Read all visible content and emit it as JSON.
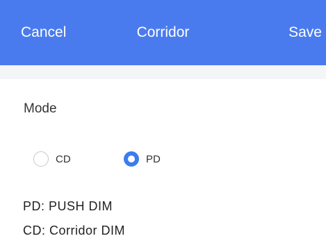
{
  "navbar": {
    "cancel_label": "Cancel",
    "title": "Corridor",
    "save_label": "Save",
    "background_color": "#4a7bee"
  },
  "mode": {
    "label": "Mode",
    "options": [
      {
        "label": "CD",
        "selected": false
      },
      {
        "label": "PD",
        "selected": true
      }
    ],
    "accent_color": "#3d7cf0"
  },
  "descriptions": {
    "pd": "PD:  PUSH DIM",
    "cd": "CD:  Corridor DIM"
  }
}
